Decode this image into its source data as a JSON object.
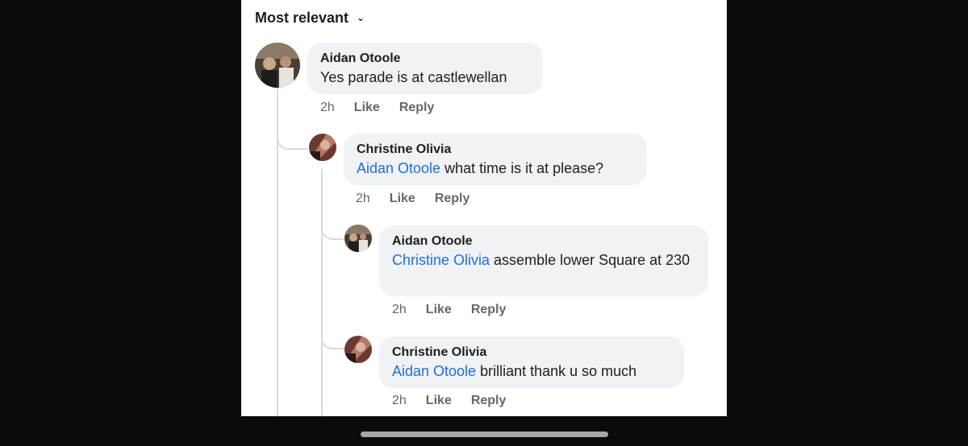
{
  "header": {
    "sort_label": "Most relevant",
    "sort_icon": "chevron-down-icon"
  },
  "comments": [
    {
      "author": "Aidan Otoole",
      "mention": "",
      "text": "Yes parade is at castlewellan",
      "time": "2h",
      "like": "Like",
      "reply": "Reply"
    },
    {
      "author": "Christine Olivia",
      "mention": "Aidan Otoole",
      "text": " what time is it at please?",
      "time": "2h",
      "like": "Like",
      "reply": "Reply"
    },
    {
      "author": "Aidan Otoole",
      "mention": "Christine Olivia",
      "text": " assemble lower Square at 230",
      "time": "2h",
      "like": "Like",
      "reply": "Reply"
    },
    {
      "author": "Christine Olivia",
      "mention": "Aidan Otoole",
      "text": " brilliant thank u so much",
      "time": "2h",
      "like": "Like",
      "reply": "Reply"
    }
  ],
  "colors": {
    "mention": "#216fdb",
    "bubble": "#f0f2f5",
    "meta": "#65676b"
  }
}
